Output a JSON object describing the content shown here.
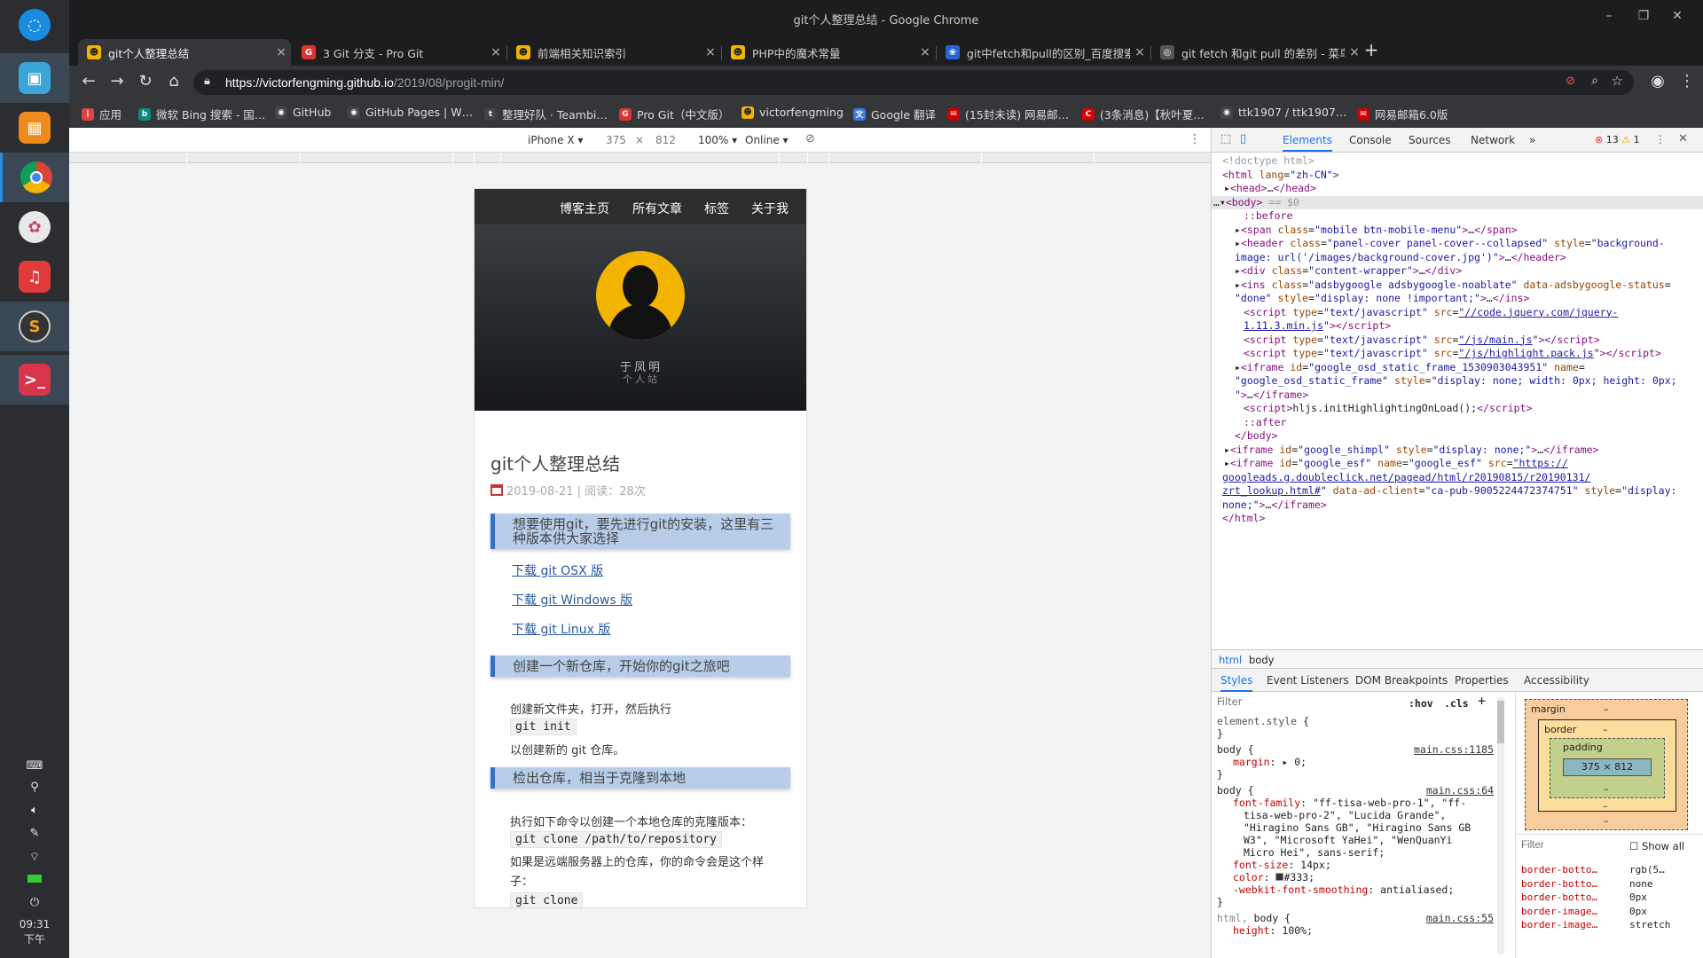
{
  "window": {
    "title": "git个人整理总结 - Google Chrome"
  },
  "tabs": [
    {
      "label": "git个人整理总结",
      "fav_color": "#f2b400",
      "fav_glyph": "☻",
      "active": true
    },
    {
      "label": "3 Git 分支 - Pro Git",
      "fav_color": "#d33",
      "fav_glyph": "G",
      "active": false
    },
    {
      "label": "前端相关知识索引",
      "fav_color": "#f2b400",
      "fav_glyph": "☻",
      "active": false
    },
    {
      "label": "PHP中的魔术常量",
      "fav_color": "#f2b400",
      "fav_glyph": "☻",
      "active": false
    },
    {
      "label": "git中fetch和pull的区别_百度搜索",
      "fav_color": "#2a63d8",
      "fav_glyph": "❀",
      "active": false
    },
    {
      "label": "git fetch 和git pull 的差别 - 菜鸟",
      "fav_color": "#555",
      "fav_glyph": "◎",
      "active": false
    }
  ],
  "toolbar": {
    "url_host": "https://victorfengming.github.io",
    "url_path": "/2019/08/progit-min/"
  },
  "bookmarks": [
    {
      "label": "应用",
      "fav_color": "#d44",
      "fav_glyph": "⋮"
    },
    {
      "label": "微软 Bing 搜索 - 国…",
      "fav_color": "#0a8a7a",
      "fav_glyph": "b"
    },
    {
      "label": "GitHub",
      "fav_color": "#444",
      "fav_glyph": "◉"
    },
    {
      "label": "GitHub Pages | W…",
      "fav_color": "#444",
      "fav_glyph": "◉"
    },
    {
      "label": "整理好队 · Teambi…",
      "fav_color": "#444",
      "fav_glyph": "t"
    },
    {
      "label": "Pro Git（中文版）",
      "fav_color": "#d33",
      "fav_glyph": "G"
    },
    {
      "label": "victorfengming",
      "fav_color": "#f2b400",
      "fav_glyph": "☻"
    },
    {
      "label": "Google 翻译",
      "fav_color": "#3b78e7",
      "fav_glyph": "文"
    },
    {
      "label": "(15封未读) 网易邮…",
      "fav_color": "#c00",
      "fav_glyph": "✉"
    },
    {
      "label": "(3条消息)【秋叶夏…",
      "fav_color": "#d00",
      "fav_glyph": "C"
    },
    {
      "label": "ttk1907 / ttk1907…",
      "fav_color": "#444",
      "fav_glyph": "◉"
    },
    {
      "label": "网易邮箱6.0版",
      "fav_color": "#c00",
      "fav_glyph": "✉"
    }
  ],
  "device_toolbar": {
    "device": "iPhone X ▾",
    "width": "375",
    "times": "×",
    "height": "812",
    "zoom": "100% ▾",
    "network": "Online ▾"
  },
  "blog": {
    "nav": [
      "博客主页",
      "所有文章",
      "标签",
      "关于我"
    ],
    "author_name": "于凤明",
    "author_sub": "个人站",
    "title": "git个人整理总结",
    "meta": "2019-08-21 | 阅读：28次",
    "callout1": "想要使用git，要先进行git的安装，这里有三种版本供大家选择",
    "downloads": [
      "下载 git OSX 版",
      "下载 git Windows 版",
      "下载 git Linux 版"
    ],
    "callout2": "创建一个新仓库，开始你的git之旅吧",
    "p_create": "创建新文件夹，打开，然后执行",
    "code_init": "git init",
    "p_create2": "以创建新的 git 仓库。",
    "callout3": "检出仓库，相当于克隆到本地",
    "p_clone": "执行如下命令以创建一个本地仓库的克隆版本：",
    "code_clone": "git clone /path/to/repository",
    "p_remote": "如果是远端服务器上的仓库，你的命令会是这个样子：",
    "code_clone2": "git clone"
  },
  "devtools": {
    "tabs": [
      "Elements",
      "Console",
      "Sources",
      "Network",
      "»"
    ],
    "errors": "13",
    "warnings": "1",
    "crumbs": [
      "html",
      "body"
    ],
    "subtabs": [
      "Styles",
      "Event Listeners",
      "DOM Breakpoints",
      "Properties",
      "Accessibility"
    ],
    "filter_placeholder": "Filter",
    "hov": ":hov",
    "cls": ".cls",
    "box_margin": "margin",
    "box_border": "border",
    "box_padding": "padding",
    "box_content": "375 × 812",
    "computed_filter": "Filter",
    "show_all": "Show all",
    "computed": [
      {
        "name": "border-botto…",
        "value": "rgb(5…"
      },
      {
        "name": "border-botto…",
        "value": "none"
      },
      {
        "name": "border-botto…",
        "value": "0px"
      },
      {
        "name": "border-image…",
        "value": "0px"
      },
      {
        "name": "border-image…",
        "value": "stretch"
      }
    ]
  },
  "clock": {
    "time": "09:31",
    "period": "下午"
  }
}
